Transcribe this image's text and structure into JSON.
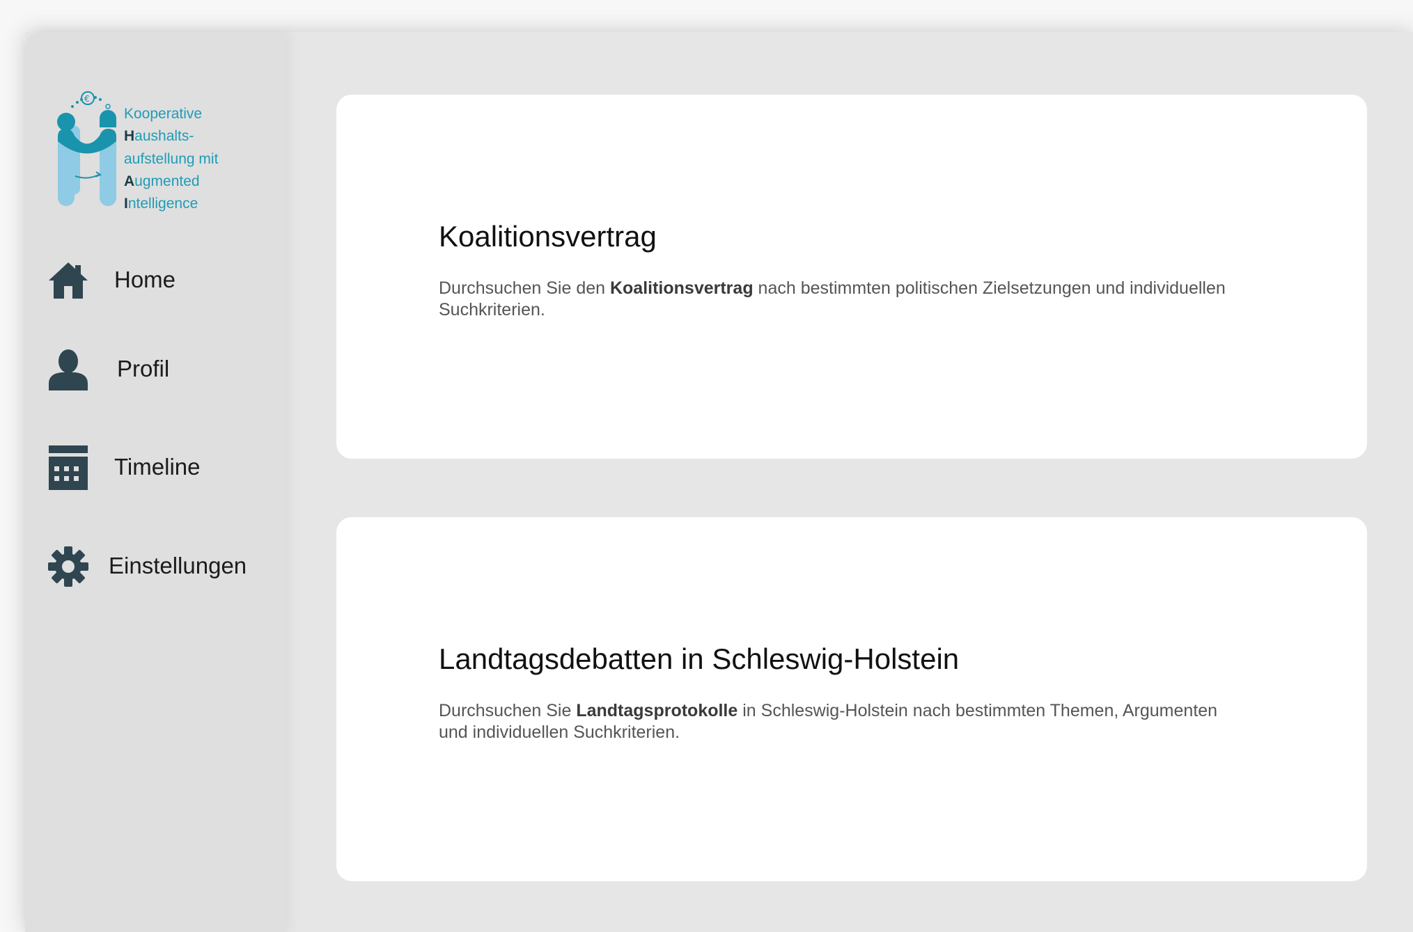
{
  "logo": {
    "lines": [
      {
        "initial": "",
        "rest": "Kooperative"
      },
      {
        "initial": "H",
        "rest": "aushalts-"
      },
      {
        "initial": "",
        "rest": "aufstellung mit"
      },
      {
        "initial": "A",
        "rest": "ugmented"
      },
      {
        "initial": "I",
        "rest": "ntelligence"
      }
    ],
    "colors": {
      "primary": "#1a93ad",
      "light": "#8fcbe4",
      "dark": "#1d3b45"
    }
  },
  "sidebar": {
    "items": [
      {
        "label": "Home",
        "icon": "home-icon"
      },
      {
        "label": "Profil",
        "icon": "user-icon"
      },
      {
        "label": "Timeline",
        "icon": "calendar-icon"
      },
      {
        "label": "Einstellungen",
        "icon": "gear-icon"
      }
    ]
  },
  "cards": [
    {
      "title": "Koalitionsvertrag",
      "desc_pre": "Durchsuchen Sie den ",
      "desc_bold": "Koalitionsvertrag",
      "desc_post": " nach bestimmten politischen Zielsetzungen und individuellen Suchkriterien."
    },
    {
      "title": "Landtagsdebatten in Schleswig-Holstein",
      "desc_pre": "Durchsuchen Sie ",
      "desc_bold": "Landtagsprotokolle",
      "desc_post": " in Schleswig-Holstein nach bestimmten Themen, Argumenten und individuellen Suchkriterien."
    }
  ],
  "colors": {
    "sidebar_bg": "#dfdfdf",
    "main_bg": "#e6e6e6",
    "card_bg": "#ffffff",
    "icon": "#2f4550"
  }
}
